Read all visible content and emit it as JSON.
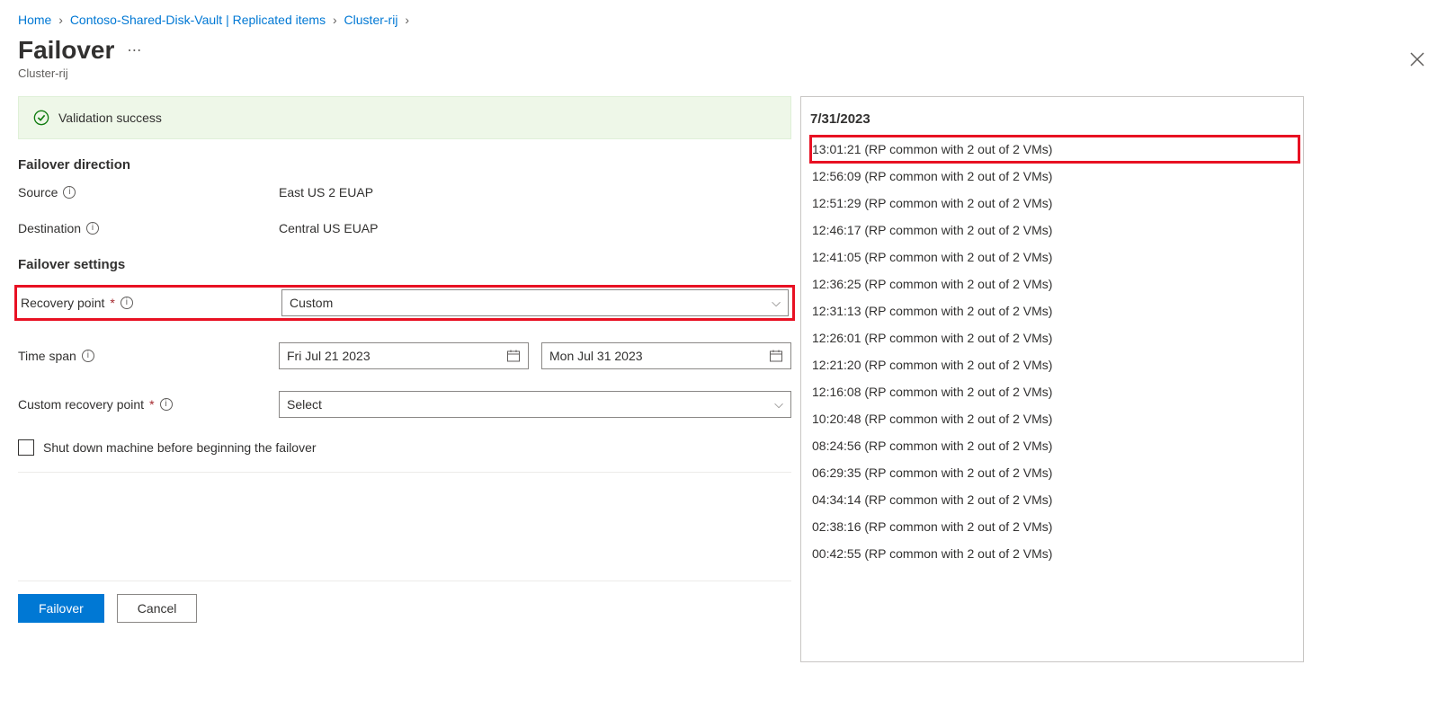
{
  "breadcrumb": {
    "home": "Home",
    "vault": "Contoso-Shared-Disk-Vault | Replicated items",
    "cluster": "Cluster-rij"
  },
  "header": {
    "title": "Failover",
    "subtitle": "Cluster-rij"
  },
  "validation": {
    "text": "Validation success"
  },
  "sections": {
    "direction_head": "Failover direction",
    "settings_head": "Failover settings"
  },
  "fields": {
    "source_label": "Source",
    "source_value": "East US 2 EUAP",
    "dest_label": "Destination",
    "dest_value": "Central US EUAP",
    "recovery_label": "Recovery point",
    "recovery_value": "Custom",
    "timespan_label": "Time span",
    "timespan_from": "Fri Jul 21 2023",
    "timespan_to": "Mon Jul 31 2023",
    "custom_rp_label": "Custom recovery point",
    "custom_rp_value": "Select",
    "shutdown_label": "Shut down machine before beginning the failover"
  },
  "footer": {
    "primary": "Failover",
    "secondary": "Cancel"
  },
  "rp_list": {
    "date": "7/31/2023",
    "items": [
      "13:01:21 (RP common with 2 out of 2 VMs)",
      "12:56:09 (RP common with 2 out of 2 VMs)",
      "12:51:29 (RP common with 2 out of 2 VMs)",
      "12:46:17 (RP common with 2 out of 2 VMs)",
      "12:41:05 (RP common with 2 out of 2 VMs)",
      "12:36:25 (RP common with 2 out of 2 VMs)",
      "12:31:13 (RP common with 2 out of 2 VMs)",
      "12:26:01 (RP common with 2 out of 2 VMs)",
      "12:21:20 (RP common with 2 out of 2 VMs)",
      "12:16:08 (RP common with 2 out of 2 VMs)",
      "10:20:48 (RP common with 2 out of 2 VMs)",
      "08:24:56 (RP common with 2 out of 2 VMs)",
      "06:29:35 (RP common with 2 out of 2 VMs)",
      "04:34:14 (RP common with 2 out of 2 VMs)",
      "02:38:16 (RP common with 2 out of 2 VMs)",
      "00:42:55 (RP common with 2 out of 2 VMs)"
    ]
  }
}
